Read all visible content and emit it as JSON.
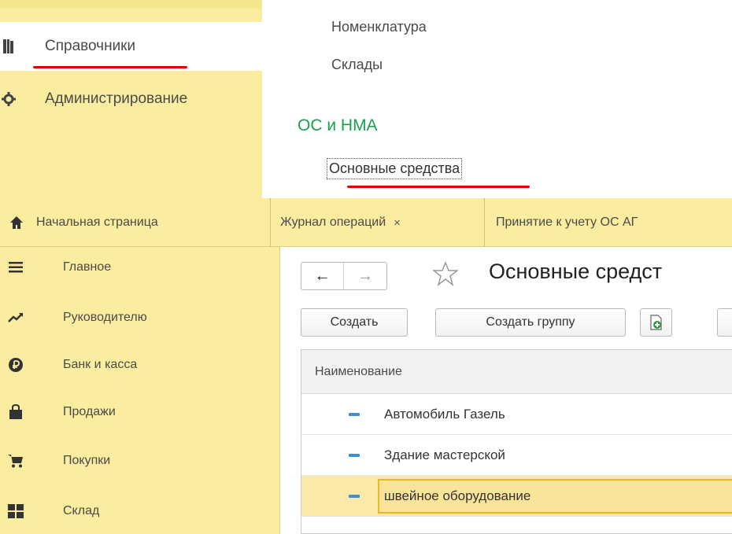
{
  "top_panel": {
    "items": [
      {
        "label": "Справочники",
        "icon": "book-icon",
        "active": true
      },
      {
        "label": "Администрирование",
        "icon": "gear-icon",
        "active": false
      }
    ]
  },
  "menu": {
    "links": [
      "Номенклатура",
      "Склады"
    ],
    "group_title": "ОС и НМА",
    "focused_link": "Основные средства"
  },
  "tabs": [
    {
      "label": "Начальная страница",
      "icon": "home-icon"
    },
    {
      "label": "Журнал операций",
      "close": "×"
    },
    {
      "label": "Принятие к учету ОС АГ"
    }
  ],
  "sections": [
    {
      "label": "Главное",
      "icon": "hamburger-icon"
    },
    {
      "label": "Руководителю",
      "icon": "trend-icon"
    },
    {
      "label": "Банк и касса",
      "icon": "ruble-icon"
    },
    {
      "label": "Продажи",
      "icon": "bag-icon"
    },
    {
      "label": "Покупки",
      "icon": "cart-icon"
    },
    {
      "label": "Склад",
      "icon": "warehouse-icon"
    }
  ],
  "content": {
    "title": "Основные средст",
    "nav": {
      "back": "←",
      "forward": "→"
    },
    "buttons": {
      "create": "Создать",
      "create_group": "Создать группу"
    },
    "list": {
      "header": "Наименование",
      "rows": [
        "Автомобиль Газель",
        "Здание мастерской",
        "швейное оборудование"
      ]
    }
  },
  "colors": {
    "panel_yellow": "#fbeda0",
    "group_green": "#1aa14b",
    "underline_red": "#e60000",
    "selection_yellow": "#fbe49a",
    "dash_blue": "#3d8fd6"
  }
}
